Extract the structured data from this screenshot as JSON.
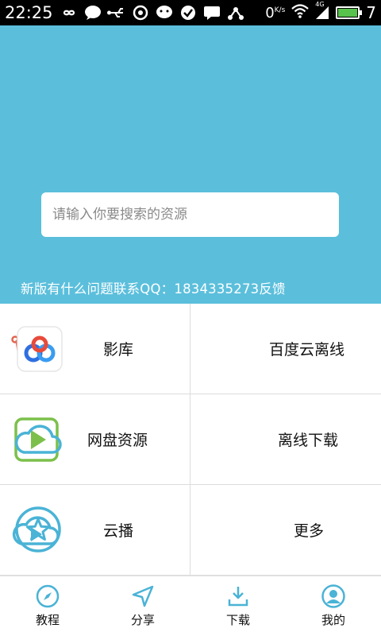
{
  "status_bar": {
    "time": "22:25",
    "net_speed": "0",
    "net_speed_unit": "K/s",
    "signal": "4G",
    "battery_level_text": "7"
  },
  "search": {
    "placeholder": "请输入你要搜索的资源"
  },
  "notice": "新版有什么问题联系QQ：1834335273反馈",
  "grid": [
    {
      "label": "影库",
      "icon": "crown-icon"
    },
    {
      "label": "百度云离线",
      "icon": "baidu-cloud-icon"
    },
    {
      "label": "网盘资源",
      "icon": "play-square-icon"
    },
    {
      "label": "离线下载",
      "icon": "cloud-icon"
    },
    {
      "label": "云播",
      "icon": "cloud-play-icon"
    },
    {
      "label": "更多",
      "icon": "star-circle-icon"
    }
  ],
  "bottom_nav": [
    {
      "label": "教程",
      "icon": "compass-icon"
    },
    {
      "label": "分享",
      "icon": "send-icon"
    },
    {
      "label": "下载",
      "icon": "download-icon"
    },
    {
      "label": "我的",
      "icon": "user-icon"
    }
  ],
  "colors": {
    "hero_bg": "#5bbfdc",
    "accent_blue": "#4ab3d6",
    "crown_red": "#e4644f",
    "green": "#7cc04b"
  }
}
